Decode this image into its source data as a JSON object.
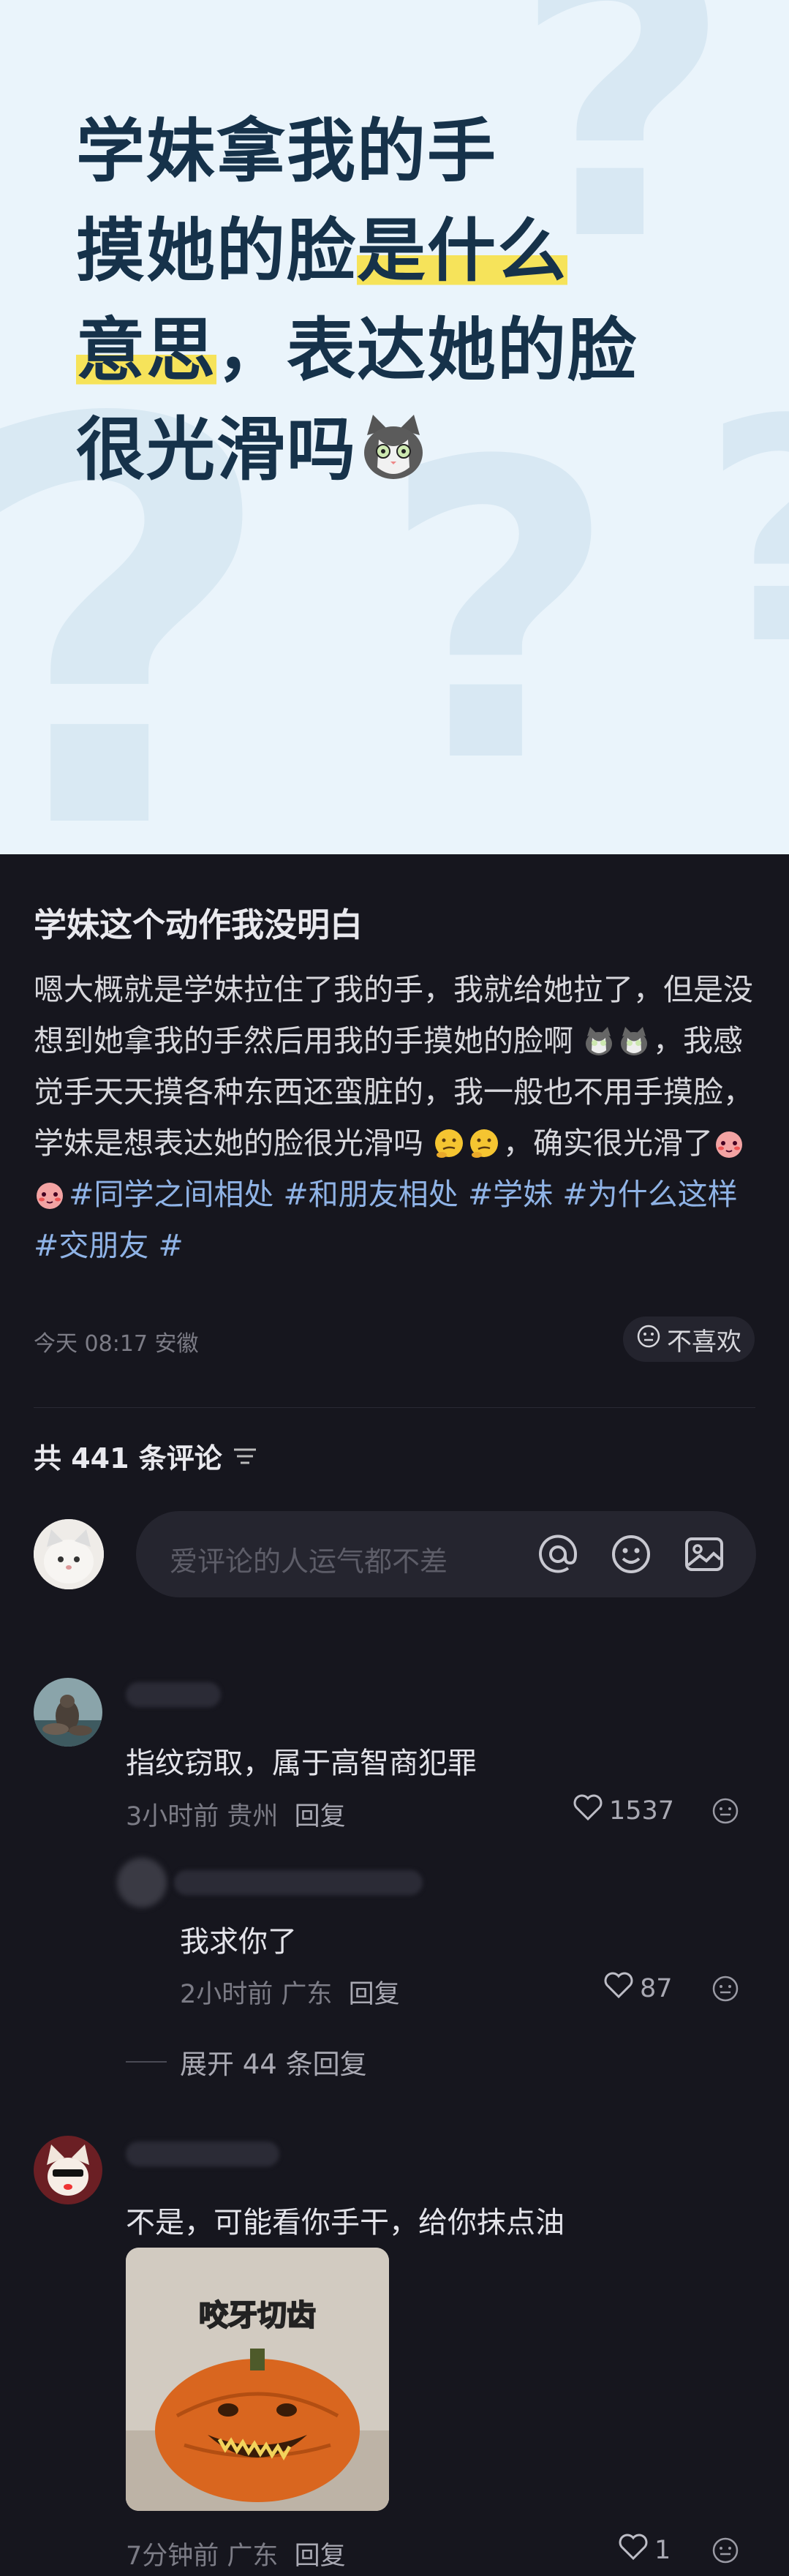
{
  "hero": {
    "line1": "学妹拿我的手",
    "line2a": "摸她的脸",
    "line2b": "是什么",
    "line3a": "意思",
    "line3b": "，表达她的脸",
    "line4": "很光滑吗"
  },
  "post": {
    "title": "学妹这个动作我没明白",
    "body_part1": "嗯大概就是学妹拉住了我的手，我就给她拉了，但是没想到她拿我的手然后用我的手摸她的脸啊",
    "body_part2": "，我感觉手天天摸各种东西还蛮脏的，我一般也不用手摸脸，学妹是想表达她的脸很光滑吗",
    "body_part3": "，确实很光滑了",
    "tags": [
      "#同学之间相处",
      "#和朋友相处",
      "#学妹",
      "#为什么这样",
      "#交朋友",
      "#"
    ],
    "timestamp": "今天 08:17 安徽",
    "dislike_label": "不喜欢"
  },
  "comments_header": {
    "count_label": "共 441 条评论"
  },
  "input": {
    "placeholder": "爱评论的人运气都不差"
  },
  "comments": [
    {
      "text": "指纹窃取，属于高智商犯罪",
      "time": "3小时前 贵州",
      "reply": "回复",
      "likes": "1537"
    },
    {
      "text": "我求你了",
      "time": "2小时前 广东",
      "reply": "回复",
      "likes": "87"
    },
    {
      "text": "不是，可能看你手干，给你抹点油",
      "time": "7分钟前 广东",
      "reply": "回复",
      "likes": "1",
      "meme_caption": "咬牙切齿"
    }
  ],
  "expand_label": "展开 44 条回复",
  "colors": {
    "hero_bg": "#eaf4fb",
    "hero_text": "#16324a",
    "highlight": "#f6e35a",
    "dark_bg": "#16161e",
    "tag": "#8fb3e6"
  }
}
